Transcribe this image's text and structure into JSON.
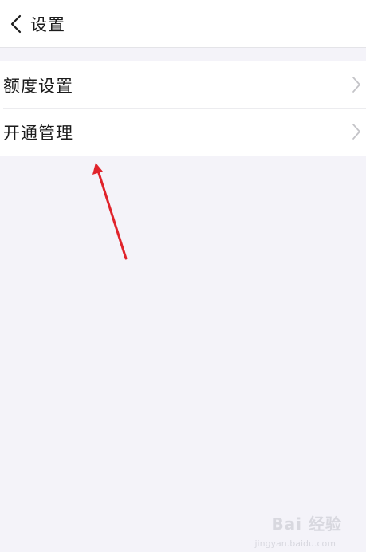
{
  "header": {
    "back_icon": "chevron-left-icon",
    "title": "设置"
  },
  "settings": {
    "items": [
      {
        "label": "额度设置",
        "icon": "chevron-right-icon"
      },
      {
        "label": "开通管理",
        "icon": "chevron-right-icon"
      }
    ]
  },
  "annotation": {
    "color": "#e0232b"
  },
  "watermark": {
    "text": "Bai 经验",
    "sub": "jingyan.baidu.com"
  }
}
